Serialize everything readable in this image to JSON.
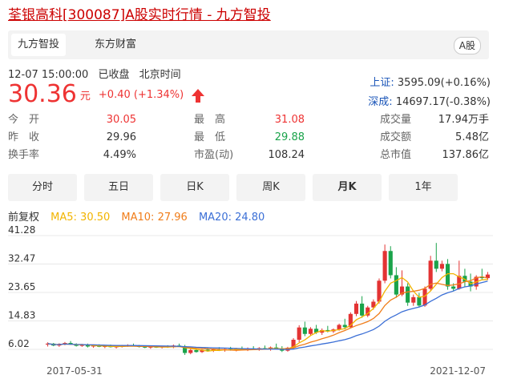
{
  "header": {
    "title": "荃银高科[300087]A股实时行情 - 九方智投"
  },
  "tabs": [
    {
      "label": "九方智投"
    },
    {
      "label": "东方财富"
    }
  ],
  "market_badge": "A股",
  "status": {
    "time": "12-07 15:00:00",
    "state": "已收盘",
    "tz": "北京时间"
  },
  "quote": {
    "price": "30.36",
    "unit": "元",
    "change": "+0.40 (+1.34%)"
  },
  "indices": [
    {
      "name": "上证:",
      "value": "3595.09(+0.16%)"
    },
    {
      "name": "深成:",
      "value": "14697.17(-0.38%)"
    }
  ],
  "stats": {
    "open": {
      "label": "今　开",
      "value": "30.05"
    },
    "prev_close": {
      "label": "昨　收",
      "value": "29.96"
    },
    "turnover_rate": {
      "label": "换手率",
      "value": "4.49%"
    },
    "high": {
      "label": "最　高",
      "value": "31.08"
    },
    "low": {
      "label": "最　低",
      "value": "29.88"
    },
    "pe": {
      "label": "市盈(动)",
      "value": "108.24"
    },
    "volume": {
      "label": "成交量",
      "value": "17.94万手"
    },
    "amount": {
      "label": "成交额",
      "value": "5.48亿"
    },
    "market_cap": {
      "label": "总市值",
      "value": "137.86亿"
    }
  },
  "periods": [
    "分时",
    "五日",
    "日K",
    "周K",
    "月K",
    "1年"
  ],
  "active_period": "月K",
  "ma": {
    "adjust": "前复权",
    "ma5": "MA5: 30.50",
    "ma10": "MA10: 27.96",
    "ma20": "MA20: 24.80"
  },
  "colors": {
    "up": "#e33333",
    "down": "#1aa34a",
    "ma5": "#f2b400",
    "ma10": "#f07d1a",
    "ma20": "#3b6fd6",
    "link": "#1a55b8"
  },
  "chart_data": {
    "type": "candlestick",
    "y_ticks": [
      "41.28",
      "32.47",
      "23.65",
      "14.83",
      "6.02"
    ],
    "x_labels": [
      "2017-05-31",
      "2021-12-07"
    ],
    "ylim": [
      6.02,
      41.28
    ],
    "candles": [
      [
        7.5,
        8.2,
        6.9,
        7.8
      ],
      [
        7.8,
        8.0,
        7.0,
        7.2
      ],
      [
        7.2,
        7.9,
        6.8,
        7.6
      ],
      [
        7.6,
        8.3,
        7.3,
        8.0
      ],
      [
        8.0,
        8.6,
        7.4,
        7.5
      ],
      [
        7.5,
        7.9,
        6.9,
        7.1
      ],
      [
        7.1,
        7.7,
        6.8,
        7.4
      ],
      [
        7.4,
        7.8,
        6.6,
        6.9
      ],
      [
        6.9,
        7.4,
        6.5,
        7.2
      ],
      [
        7.2,
        7.6,
        6.7,
        6.8
      ],
      [
        6.8,
        7.3,
        6.4,
        7.0
      ],
      [
        7.0,
        7.5,
        6.6,
        6.7
      ],
      [
        6.7,
        7.1,
        6.3,
        6.9
      ],
      [
        6.9,
        7.4,
        6.6,
        7.1
      ],
      [
        7.1,
        7.6,
        6.8,
        7.3
      ],
      [
        7.3,
        7.8,
        7.0,
        7.0
      ],
      [
        7.0,
        7.4,
        6.6,
        6.8
      ],
      [
        6.8,
        7.2,
        6.4,
        6.6
      ],
      [
        6.6,
        7.0,
        6.2,
        6.8
      ],
      [
        6.8,
        7.2,
        6.5,
        6.6
      ],
      [
        6.6,
        7.1,
        6.3,
        6.9
      ],
      [
        6.9,
        7.3,
        6.5,
        6.7
      ],
      [
        6.7,
        7.5,
        6.4,
        7.2
      ],
      [
        7.2,
        7.8,
        6.9,
        7.0
      ],
      [
        7.0,
        7.4,
        4.3,
        4.9
      ],
      [
        4.9,
        6.2,
        4.5,
        5.8
      ],
      [
        5.8,
        6.4,
        5.0,
        5.2
      ],
      [
        5.2,
        6.1,
        4.9,
        5.9
      ],
      [
        5.9,
        6.5,
        5.3,
        5.6
      ],
      [
        5.6,
        6.3,
        5.2,
        6.0
      ],
      [
        6.0,
        6.7,
        5.5,
        5.7
      ],
      [
        5.7,
        6.4,
        5.3,
        6.1
      ],
      [
        6.1,
        6.8,
        5.6,
        5.8
      ],
      [
        5.8,
        6.5,
        5.4,
        6.2
      ],
      [
        6.2,
        6.9,
        5.7,
        5.9
      ],
      [
        5.9,
        6.6,
        5.5,
        6.3
      ],
      [
        6.3,
        7.0,
        5.8,
        6.0
      ],
      [
        6.0,
        6.7,
        5.6,
        6.4
      ],
      [
        6.4,
        7.2,
        5.9,
        6.1
      ],
      [
        6.1,
        6.9,
        5.6,
        6.6
      ],
      [
        6.6,
        7.8,
        6.2,
        6.3
      ],
      [
        6.3,
        7.0,
        5.2,
        5.6
      ],
      [
        5.6,
        6.8,
        5.3,
        6.5
      ],
      [
        6.5,
        9.5,
        6.2,
        9.0
      ],
      [
        9.0,
        13.5,
        8.2,
        12.8
      ],
      [
        12.8,
        14.6,
        10.1,
        10.8
      ],
      [
        10.8,
        12.9,
        10.2,
        12.4
      ],
      [
        12.4,
        13.6,
        10.8,
        11.2
      ],
      [
        11.2,
        12.5,
        10.5,
        12.0
      ],
      [
        12.0,
        13.3,
        11.3,
        11.6
      ],
      [
        11.6,
        12.5,
        11.1,
        12.2
      ],
      [
        12.2,
        14.0,
        11.8,
        13.6
      ],
      [
        13.6,
        15.5,
        12.2,
        12.9
      ],
      [
        12.9,
        17.5,
        12.6,
        17.0
      ],
      [
        17.0,
        21.0,
        16.3,
        20.2
      ],
      [
        20.2,
        22.5,
        15.8,
        16.5
      ],
      [
        16.5,
        19.5,
        16.0,
        19.0
      ],
      [
        19.0,
        21.5,
        18.3,
        20.8
      ],
      [
        20.8,
        28.0,
        20.2,
        27.3
      ],
      [
        27.3,
        38.5,
        26.5,
        36.5
      ],
      [
        36.5,
        38.0,
        28.0,
        29.0
      ],
      [
        29.0,
        31.5,
        22.0,
        23.0
      ],
      [
        23.0,
        30.5,
        22.5,
        25.5
      ],
      [
        25.5,
        26.5,
        19.5,
        20.5
      ],
      [
        20.5,
        23.0,
        19.5,
        22.2
      ],
      [
        22.2,
        23.5,
        19.0,
        19.6
      ],
      [
        19.6,
        25.5,
        19.2,
        24.8
      ],
      [
        24.8,
        35.0,
        24.2,
        33.5
      ],
      [
        33.5,
        39.0,
        30.0,
        31.0
      ],
      [
        31.0,
        33.5,
        30.2,
        32.5
      ],
      [
        32.5,
        34.0,
        24.5,
        25.5
      ],
      [
        25.5,
        26.5,
        24.0,
        24.8
      ],
      [
        24.8,
        33.5,
        24.5,
        28.8
      ],
      [
        28.8,
        31.0,
        25.5,
        27.0
      ],
      [
        27.0,
        29.5,
        24.0,
        25.5
      ],
      [
        25.5,
        29.0,
        24.5,
        28.5
      ],
      [
        28.5,
        31.0,
        27.5,
        28.1
      ],
      [
        28.1,
        30.0,
        27.5,
        29.2
      ]
    ]
  }
}
